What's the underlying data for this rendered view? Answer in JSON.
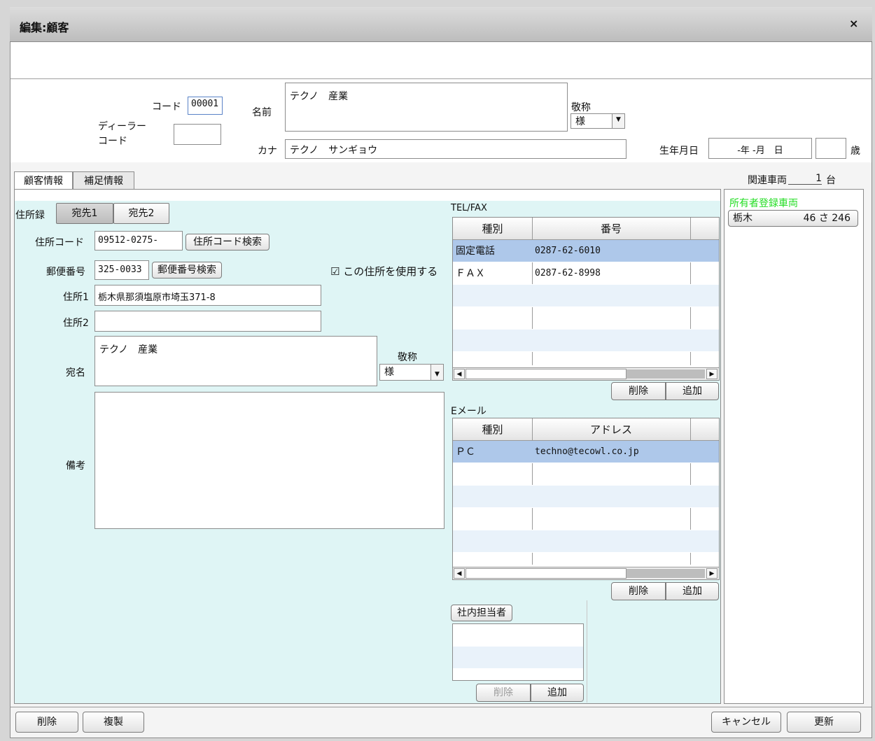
{
  "window": {
    "title": "編集:顧客",
    "close": "×"
  },
  "header": {
    "code_label": "コード",
    "code_value": "00001",
    "dealer_code_label_1": "ディーラー",
    "dealer_code_label_2": "コード",
    "dealer_code_value": "",
    "name_label": "名前",
    "name_value": "テクノ　産業",
    "honorific_label": "敬称",
    "honorific_value": "様",
    "kana_label": "カナ",
    "kana_value": "テクノ　サンギョウ",
    "birthday_label": "生年月日",
    "birthday_value": "-年 -月　日",
    "age_value": "",
    "age_unit": "歳"
  },
  "tabs": [
    "顧客情報",
    "補足情報"
  ],
  "address": {
    "book_label": "住所録",
    "dest_tabs": [
      "宛先1",
      "宛先2"
    ],
    "addr_code_label": "住所コード",
    "addr_code_value": "09512-0275-",
    "addr_code_search": "住所コード検索",
    "postal_label": "郵便番号",
    "postal_value": "325-0033",
    "postal_search": "郵便番号検索",
    "use_address_label": "この住所を使用する",
    "use_address_checked": true,
    "addr1_label": "住所1",
    "addr1_value": "栃木県那須塩原市埼玉371-8",
    "addr2_label": "住所2",
    "addr2_value": "",
    "recipient_label": "宛名",
    "recipient_value": "テクノ　産業",
    "recipient_honorific_label": "敬称",
    "recipient_honorific_value": "様",
    "notes_label": "備考",
    "notes_value": ""
  },
  "tel": {
    "section_label": "TEL/FAX",
    "col_type": "種別",
    "col_number": "番号",
    "rows": [
      {
        "type": "固定電話",
        "number": "0287-62-6010"
      },
      {
        "type": "ＦＡＸ",
        "number": "0287-62-8998"
      }
    ],
    "delete": "削除",
    "add": "追加"
  },
  "email": {
    "section_label": "Eメール",
    "col_type": "種別",
    "col_address": "アドレス",
    "rows": [
      {
        "type": "ＰＣ",
        "address": "techno@tecowl.co.jp"
      }
    ],
    "delete": "削除",
    "add": "追加"
  },
  "staff": {
    "button": "社内担当者",
    "delete": "削除",
    "add": "追加"
  },
  "vehicles": {
    "label": "関連車両",
    "count": "1",
    "unit": "台",
    "owner_label": "所有者登録車両",
    "plates": [
      {
        "region": "栃木",
        "number": "46 さ 246"
      }
    ]
  },
  "footer": {
    "delete": "削除",
    "duplicate": "複製",
    "cancel": "キャンセル",
    "update": "更新"
  },
  "colors": {
    "owner_label": "#22dd22",
    "selected_row": "#aec8ea",
    "panel_bg": "#dff5f5"
  }
}
